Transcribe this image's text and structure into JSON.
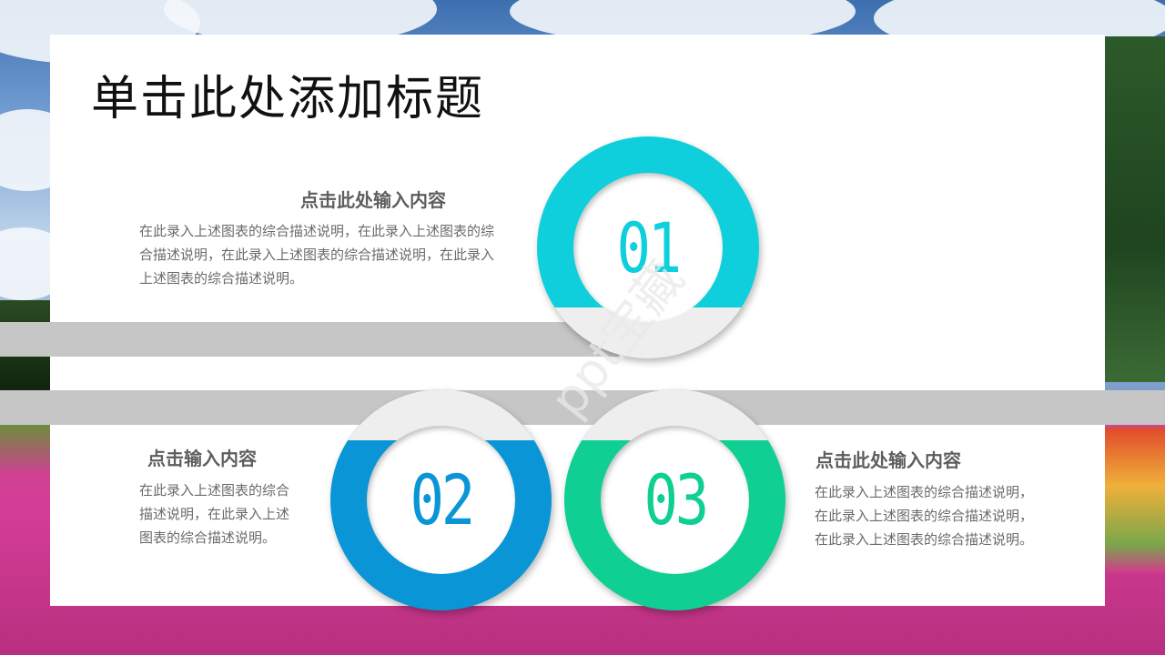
{
  "slide": {
    "title": "单击此处添加标题",
    "watermark": "ppt宝藏"
  },
  "items": [
    {
      "number": "01",
      "heading": "点击此处输入内容",
      "description": "在此录入上述图表的综合描述说明，在此录入上述图表的综合描述说明，在此录入上述图表的综合描述说明，在此录入上述图表的综合描述说明。",
      "color": "#10cfdc"
    },
    {
      "number": "02",
      "heading": "点击输入内容",
      "description": "在此录入上述图表的综合描述说明，在此录入上述图表的综合描述说明。",
      "color": "#0a96d6"
    },
    {
      "number": "03",
      "heading": "点击此处输入内容",
      "description": "在此录入上述图表的综合描述说明，在此录入上述图表的综合描述说明，在此录入上述图表的综合描述说明。",
      "color": "#10cf93"
    }
  ],
  "colors": {
    "ring_gray": "#eeeeee",
    "band_gray": "#c6c6c6"
  }
}
